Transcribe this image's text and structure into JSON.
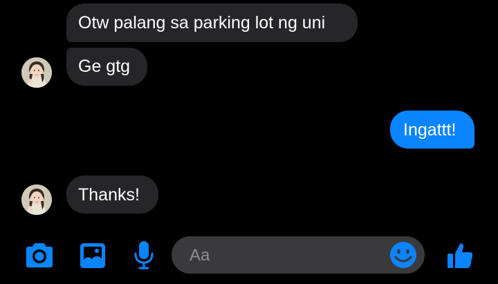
{
  "conversation": {
    "messages": [
      {
        "sender": "other",
        "text": "Otw palang sa parking lot ng uni"
      },
      {
        "sender": "other",
        "text": "Ge gtg"
      },
      {
        "sender": "me",
        "text": "Ingattt!"
      },
      {
        "sender": "other",
        "text": "Thanks!"
      }
    ]
  },
  "composer": {
    "placeholder": "Aa",
    "icons": {
      "camera": "camera-icon",
      "gallery": "image-icon",
      "voice": "microphone-icon",
      "emoji": "smiley-icon",
      "like": "thumbs-up-icon"
    }
  },
  "colors": {
    "background": "#000000",
    "incoming_bubble": "#262628",
    "outgoing_bubble": "#0a84ff",
    "accent": "#0a84ff",
    "input_background": "#3a3a3c",
    "placeholder": "#8e8e93"
  }
}
